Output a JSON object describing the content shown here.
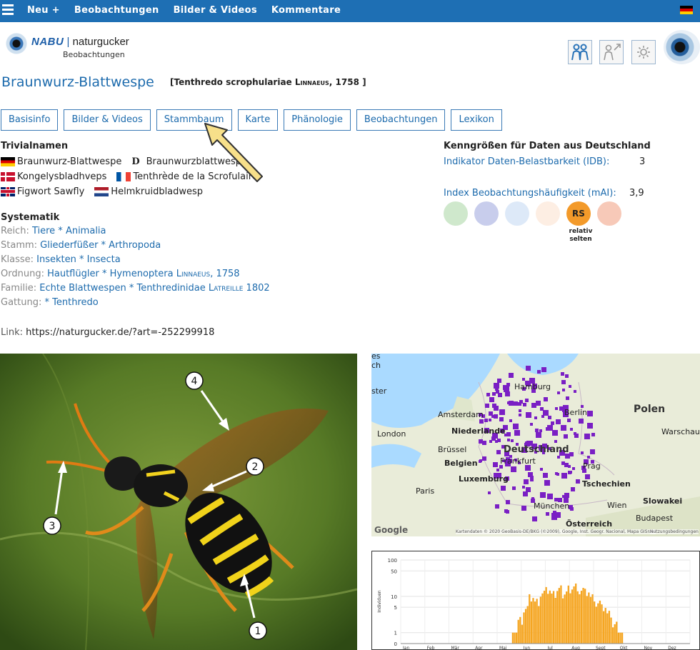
{
  "topbar": {
    "nav": [
      "Neu +",
      "Beobachtungen",
      "Bilder & Videos",
      "Kommentare"
    ]
  },
  "header": {
    "logo_brand": "NABU",
    "logo_name": "naturgucker",
    "logo_sub": "Beobachtungen"
  },
  "title": {
    "common": "Braunwurz-Blattwespe",
    "scientific_prefix": "[Tenthredo scrophulariae ",
    "author": "Linnaeus",
    "scientific_suffix": ", 1758 ]"
  },
  "tabs": [
    "Basisinfo",
    "Bilder & Videos",
    "Stammbaum",
    "Karte",
    "Phänologie",
    "Beobachtungen",
    "Lexikon"
  ],
  "trivialnamen": {
    "heading": "Trivialnamen",
    "de": "Braunwurz-Blattwespe",
    "d_glyph": "D",
    "de_alt": "Braunwurzblattwespe",
    "dk": "Kongelysbladhveps",
    "fr": "Tenthrède de la Scrofulaire",
    "en": "Figwort Sawfly",
    "nl": "Helmkruidbladwesp"
  },
  "systematik": {
    "heading": "Systematik",
    "rows": [
      {
        "label": "Reich:",
        "value": "Tiere * Animalia",
        "author": ""
      },
      {
        "label": "Stamm:",
        "value": "Gliederfüßer * Arthropoda",
        "author": ""
      },
      {
        "label": "Klasse:",
        "value": "Insekten * Insecta",
        "author": ""
      },
      {
        "label": "Ordnung:",
        "value": "Hautflügler * Hymenoptera",
        "author": "Linnaeus, 1758"
      },
      {
        "label": "Familie:",
        "value": "Echte Blattwespen * Tenthredinidae",
        "author": "Latreille 1802"
      },
      {
        "label": "Gattung:",
        "value": " * Tenthredo",
        "author": ""
      }
    ]
  },
  "link": {
    "label": "Link:",
    "url": "https://naturgucker.de/?art=-252299918"
  },
  "kenngroessen": {
    "heading": "Kenngrößen für Daten aus Deutschland",
    "idb_label": "Indikator Daten-Belastbarkeit (IDB):",
    "idb_value": "3",
    "mai_label": "Index Beobachtungshäufigkeit (mAI):",
    "mai_value": "3,9",
    "circles": [
      {
        "color": "#cfe8cc",
        "text": ""
      },
      {
        "color": "#c8cdec",
        "text": ""
      },
      {
        "color": "#dde9f8",
        "text": ""
      },
      {
        "color": "#fdeee3",
        "text": ""
      },
      {
        "color": "#f39a2a",
        "text": "RS"
      },
      {
        "color": "#f7c9b8",
        "text": ""
      }
    ],
    "active_label": "relativ selten"
  },
  "photo": {
    "markers": [
      "1",
      "2",
      "3",
      "4"
    ]
  },
  "map": {
    "labels": {
      "amsterdam": "Amsterdam",
      "niederlande": "Niederlande",
      "london": "London",
      "bruessel": "Brüssel",
      "belgien": "Belgien",
      "luxemburg": "Luxemburg",
      "paris": "Paris",
      "hamburg": "Hamburg",
      "berlin": "Berlin",
      "polen": "Polen",
      "warschau": "Warschau",
      "deutschland": "Deutschland",
      "prag": "Prag",
      "tschechien": "Tschechien",
      "frankfurt": "Frankfurt",
      "muenchen": "München",
      "wien": "Wien",
      "slowakei": "Slowakei",
      "budapest": "Budapest",
      "oesterreich": "Österreich",
      "es": "es",
      "ch": "ch",
      "ster": "ster"
    },
    "google": "Google",
    "attribution": "Kartendaten © 2020 GeoBasis-DE/BKG (©2009), Google, Inst. Geogr. Nacional, Mapa GISrael",
    "terms": "Nutzungsbedingungen"
  },
  "chart_data": {
    "type": "bar",
    "ylabel": "Individuen",
    "yscale": "log",
    "yticks": [
      "100",
      "50",
      "10",
      "5",
      "1",
      "0"
    ],
    "months": [
      "Jan",
      "Feb",
      "Mär",
      "Apr",
      "Mai",
      "Jun",
      "Jul",
      "Aug",
      "Sept",
      "Okt",
      "Nov",
      "Dez"
    ],
    "bar_color": "#f5a623",
    "bars_by_week": [
      {
        "week": 21,
        "value": 1
      },
      {
        "week": 22,
        "value": 3
      },
      {
        "week": 23,
        "value": 6
      },
      {
        "week": 24,
        "value": 12
      },
      {
        "week": 25,
        "value": 9
      },
      {
        "week": 26,
        "value": 15
      },
      {
        "week": 27,
        "value": 18
      },
      {
        "week": 28,
        "value": 14
      },
      {
        "week": 29,
        "value": 20
      },
      {
        "week": 30,
        "value": 16
      },
      {
        "week": 31,
        "value": 22
      },
      {
        "week": 32,
        "value": 25
      },
      {
        "week": 33,
        "value": 19
      },
      {
        "week": 34,
        "value": 17
      },
      {
        "week": 35,
        "value": 12
      },
      {
        "week": 36,
        "value": 8
      },
      {
        "week": 37,
        "value": 6
      },
      {
        "week": 38,
        "value": 4
      },
      {
        "week": 39,
        "value": 2
      },
      {
        "week": 40,
        "value": 1
      }
    ]
  }
}
